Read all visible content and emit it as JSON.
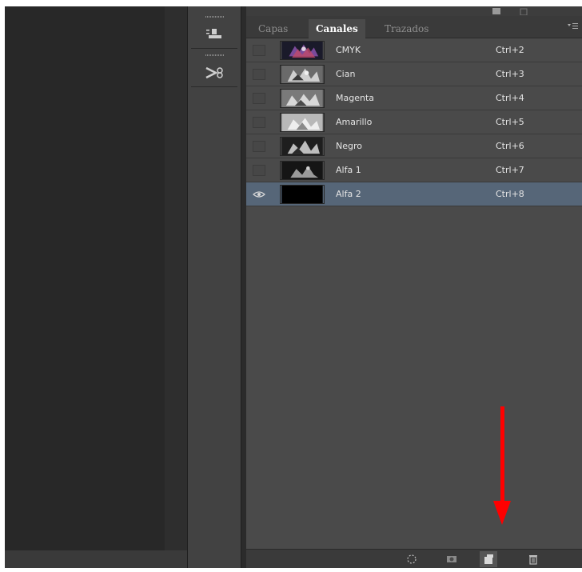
{
  "panel": {
    "tabs": [
      {
        "label": "Capas"
      },
      {
        "label": "Canales"
      },
      {
        "label": "Trazados"
      }
    ],
    "active_tab": "Canales",
    "channels": [
      {
        "name": "CMYK",
        "shortcut": "Ctrl+2",
        "visible": false,
        "thumb": "color"
      },
      {
        "name": "Cian",
        "shortcut": "Ctrl+3",
        "visible": false,
        "thumb": "gray"
      },
      {
        "name": "Magenta",
        "shortcut": "Ctrl+4",
        "visible": false,
        "thumb": "gray"
      },
      {
        "name": "Amarillo",
        "shortcut": "Ctrl+5",
        "visible": false,
        "thumb": "light"
      },
      {
        "name": "Negro",
        "shortcut": "Ctrl+6",
        "visible": false,
        "thumb": "dark"
      },
      {
        "name": "Alfa 1",
        "shortcut": "Ctrl+7",
        "visible": false,
        "thumb": "dark"
      },
      {
        "name": "Alfa 2",
        "shortcut": "Ctrl+8",
        "visible": true,
        "thumb": "black",
        "selected": true
      }
    ],
    "footer_icons": [
      "load-selection-icon",
      "save-selection-mask-icon",
      "new-channel-icon",
      "delete-channel-icon"
    ]
  },
  "toolstrip_icons": [
    "channel-options-icon",
    "scissors-icon"
  ],
  "colors": {
    "panel_bg": "#4a4a4a",
    "selected_row": "#566678",
    "annotation_arrow": "#ff0000"
  }
}
